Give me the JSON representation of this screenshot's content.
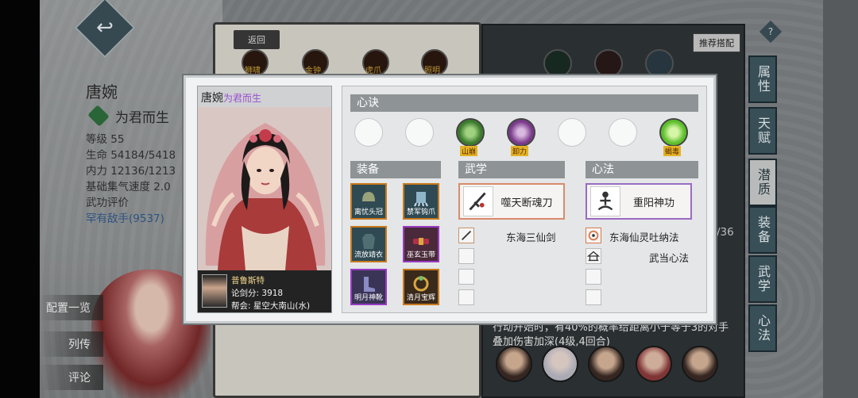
{
  "background": {
    "character_name": "唐婉",
    "character_title": "为君而生",
    "stats": [
      "等级 55",
      "生命 54184/5418",
      "内力 12136/1213",
      "基础集气速度 2.0"
    ],
    "rating_label": "武功评价",
    "rating_value": "罕有敌手(9537)",
    "side_buttons": [
      "配置一览",
      "列传",
      "评论"
    ],
    "back_label": "返回",
    "book_skill_labels": [
      "狮啸",
      "金钟",
      "虎爪",
      "照明"
    ],
    "recommend_label": "推荐搭配",
    "help_label": "?",
    "tabs": [
      "属性",
      "天赋",
      "潜质",
      "装备",
      "武学",
      "心法"
    ],
    "active_tab": "潜质",
    "page_fraction": "/36",
    "description": "行动开始时，有40%的概率给距离小于等于3的对手叠加伤害加深(4级,4回合)"
  },
  "modal": {
    "card": {
      "name": "唐婉",
      "title": "为君而生",
      "player_name": "普鲁斯特",
      "sword_score_label": "论剑分:",
      "sword_score": "3918",
      "guild_label": "帮会:",
      "guild": "星空大南山(水)"
    },
    "xinjue": {
      "header": "心诀",
      "slots": [
        {
          "filled": false
        },
        {
          "filled": false
        },
        {
          "filled": true,
          "label": "山崩",
          "icon": "mountain-icon",
          "color": "#3c7a2e"
        },
        {
          "filled": true,
          "label": "卸力",
          "icon": "swirl-icon",
          "color": "#7a3a8a"
        },
        {
          "filled": false
        },
        {
          "filled": false
        },
        {
          "filled": true,
          "label": "蝎毒",
          "icon": "skull-icon",
          "color": "#5cbf2a"
        }
      ]
    },
    "equipment": {
      "header": "装备",
      "items": [
        {
          "label": "离忧头冠",
          "rarity": "orange",
          "icon": "helmet-icon"
        },
        {
          "label": "禁军钩爪",
          "rarity": "orange",
          "icon": "claw-icon"
        },
        {
          "label": "流放靖衣",
          "rarity": "orange",
          "icon": "robe-icon"
        },
        {
          "label": "巫玄玉带",
          "rarity": "purple",
          "icon": "belt-icon"
        },
        {
          "label": "明月神靴",
          "rarity": "purple",
          "icon": "boots-icon"
        },
        {
          "label": "清月宝辉",
          "rarity": "orange",
          "icon": "ring-icon"
        }
      ]
    },
    "martial": {
      "header": "武学",
      "main": {
        "label": "噬天断魂刀",
        "icon": "blade-icon"
      },
      "others": [
        {
          "label": "东海三仙剑",
          "icon": "sword-icon",
          "filled": true
        },
        {
          "label": "",
          "filled": false
        },
        {
          "label": "",
          "filled": false
        },
        {
          "label": "",
          "filled": false
        }
      ]
    },
    "xinfa": {
      "header": "心法",
      "main": {
        "label": "重阳神功",
        "icon": "meditation-icon"
      },
      "others": [
        {
          "label": "东海仙灵吐纳法",
          "icon": "wave-emblem-icon",
          "filled": true
        },
        {
          "label": "武当心法",
          "icon": "temple-icon",
          "filled": true
        },
        {
          "label": "",
          "filled": false
        },
        {
          "label": "",
          "filled": false
        }
      ]
    }
  }
}
